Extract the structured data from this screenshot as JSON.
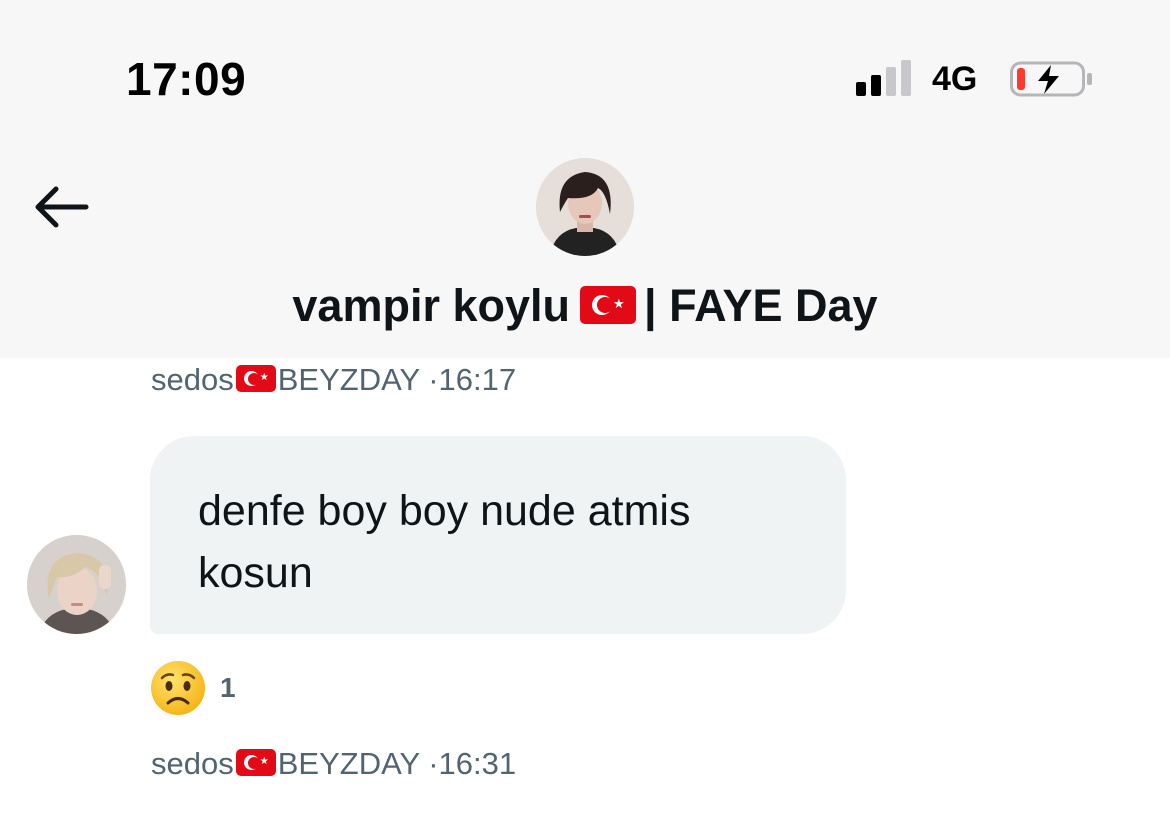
{
  "status_bar": {
    "time": "17:09",
    "network": "4G",
    "signal_bars": 2,
    "battery_level": 0.12,
    "battery_charging": true,
    "battery_color": "#ff3b30"
  },
  "header": {
    "back_icon": "arrow-left-icon",
    "conversation_name": "vampir koylu",
    "name_suffix": "| FAYE Day",
    "name_flag": "turkey-flag-icon",
    "avatar": "profile-avatar"
  },
  "messages": [
    {
      "sender_prefix": "sedos",
      "sender_suffix": "BEYZDAY",
      "time": "·16:17",
      "text_line1": "denfe boy boy nude atmis",
      "text_line2": "kosun",
      "reaction": {
        "emoji_icon": "worried-face-icon",
        "count": "1"
      }
    }
  ],
  "next_meta": {
    "sender_prefix": "sedos",
    "sender_suffix": "BEYZDAY",
    "time": "·16:31"
  },
  "colors": {
    "header_bg": "#f7f7f8",
    "bubble_bg": "#eff3f4",
    "meta_text": "#536471",
    "primary_text": "#0f1419",
    "flag_red": "#e30a17"
  }
}
